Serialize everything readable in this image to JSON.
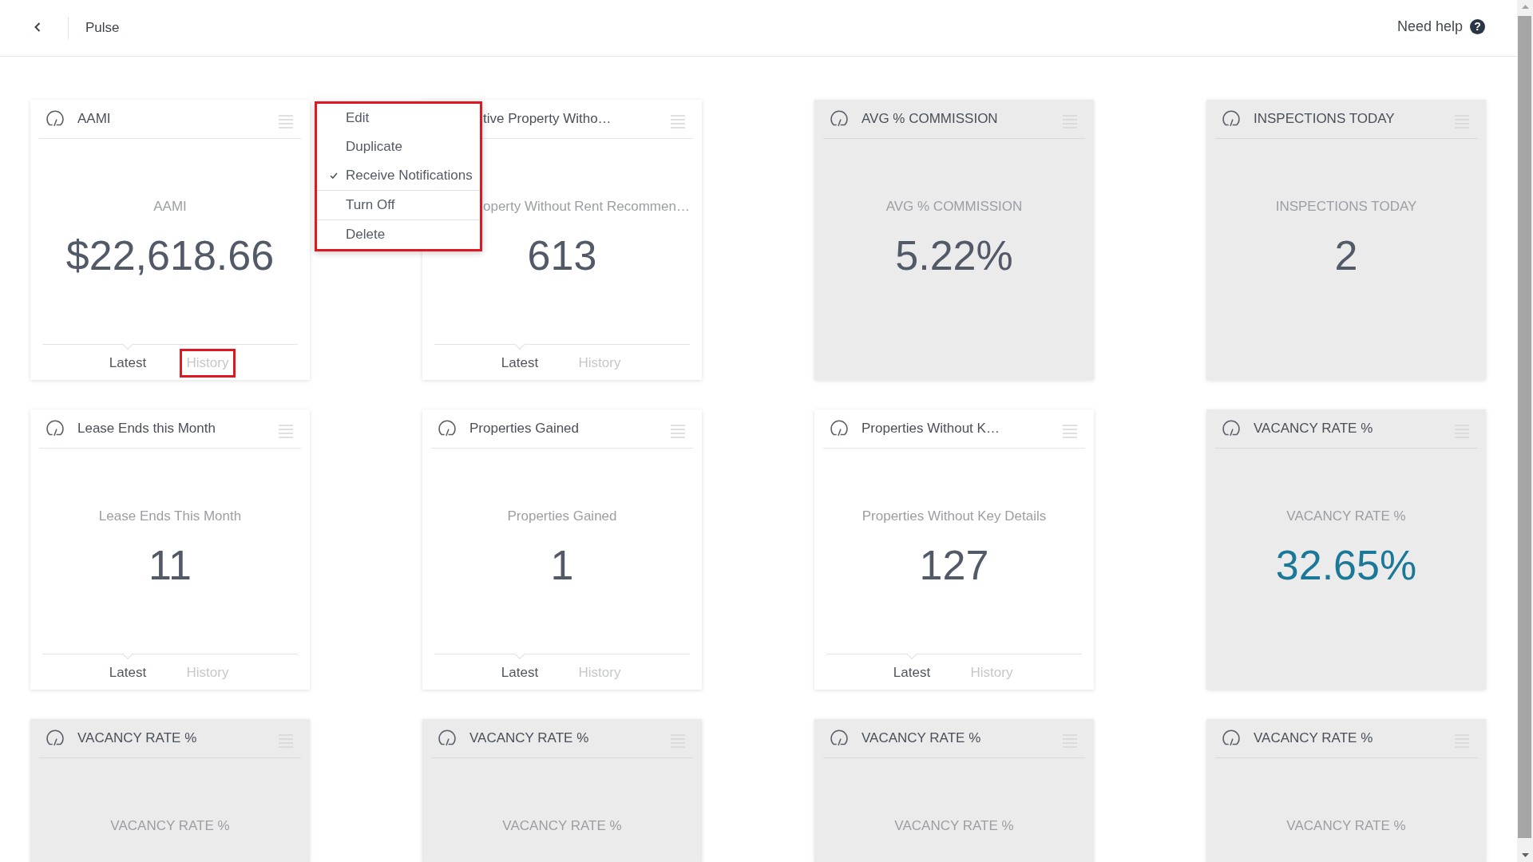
{
  "top_bar": {
    "title": "Pulse",
    "help": {
      "label": "Need help",
      "icon": "?"
    }
  },
  "cards": [
    {
      "title": "AAMI",
      "subtitle": "AAMI",
      "value": "$22,618.66",
      "color": "#535a67",
      "disabled": false,
      "covered_by_menu": false,
      "tabs": [
        {
          "label": "Latest",
          "selected": true,
          "annotated": false
        },
        {
          "label": "History",
          "selected": false,
          "annotated": true
        }
      ]
    },
    {
      "title": "tive Property Witho…",
      "subtitle": "operty Without Rent Recommen…",
      "value": "613",
      "color": "#535a67",
      "disabled": false,
      "covered_by_menu": true,
      "tabs": [
        {
          "label": "Latest",
          "selected": true,
          "annotated": false
        },
        {
          "label": "History",
          "selected": false,
          "annotated": false
        }
      ]
    },
    {
      "title": "AVG % COMMISSION",
      "subtitle": "AVG % COMMISSION",
      "value": "5.22%",
      "color": "#535a67",
      "disabled": true,
      "covered_by_menu": false
    },
    {
      "title": "INSPECTIONS TODAY",
      "subtitle": "INSPECTIONS TODAY",
      "value": "2",
      "color": "#535a67",
      "disabled": true,
      "covered_by_menu": false
    },
    {
      "title": "Lease Ends this Month",
      "subtitle": "Lease Ends This Month",
      "value": "11",
      "color": "#535a67",
      "disabled": false,
      "covered_by_menu": false,
      "tabs": [
        {
          "label": "Latest",
          "selected": true,
          "annotated": false
        },
        {
          "label": "History",
          "selected": false,
          "annotated": false
        }
      ]
    },
    {
      "title": "Properties Gained",
      "subtitle": "Properties Gained",
      "value": "1",
      "color": "#535a67",
      "disabled": false,
      "covered_by_menu": false,
      "tabs": [
        {
          "label": "Latest",
          "selected": true,
          "annotated": false
        },
        {
          "label": "History",
          "selected": false,
          "annotated": false
        }
      ]
    },
    {
      "title": "Properties Without K…",
      "subtitle": "Properties Without Key Details",
      "value": "127",
      "color": "#535a67",
      "disabled": false,
      "covered_by_menu": false,
      "tabs": [
        {
          "label": "Latest",
          "selected": true,
          "annotated": false
        },
        {
          "label": "History",
          "selected": false,
          "annotated": false
        }
      ]
    },
    {
      "title": "VACANCY RATE %",
      "subtitle": "VACANCY RATE %",
      "value": "32.65%",
      "color": "#1b7896",
      "disabled": true,
      "covered_by_menu": false
    },
    {
      "title": "VACANCY RATE %",
      "subtitle": "VACANCY RATE %",
      "disabled": true,
      "covered_by_menu": false
    },
    {
      "title": "VACANCY RATE %",
      "subtitle": "VACANCY RATE %",
      "disabled": true,
      "covered_by_menu": false
    },
    {
      "title": "VACANCY RATE %",
      "subtitle": "VACANCY RATE %",
      "disabled": true,
      "covered_by_menu": false
    },
    {
      "title": "VACANCY RATE %",
      "subtitle": "VACANCY RATE %",
      "disabled": true,
      "covered_by_menu": false
    }
  ],
  "card_menu": {
    "annotated": true,
    "sections": [
      {
        "items": [
          {
            "label": "Edit",
            "checked": false
          },
          {
            "label": "Duplicate",
            "checked": false
          },
          {
            "label": "Receive Notifications",
            "checked": true
          }
        ]
      },
      {
        "items": [
          {
            "label": "Turn Off",
            "checked": false
          }
        ]
      },
      {
        "items": [
          {
            "label": "Delete",
            "checked": false
          }
        ]
      }
    ]
  }
}
